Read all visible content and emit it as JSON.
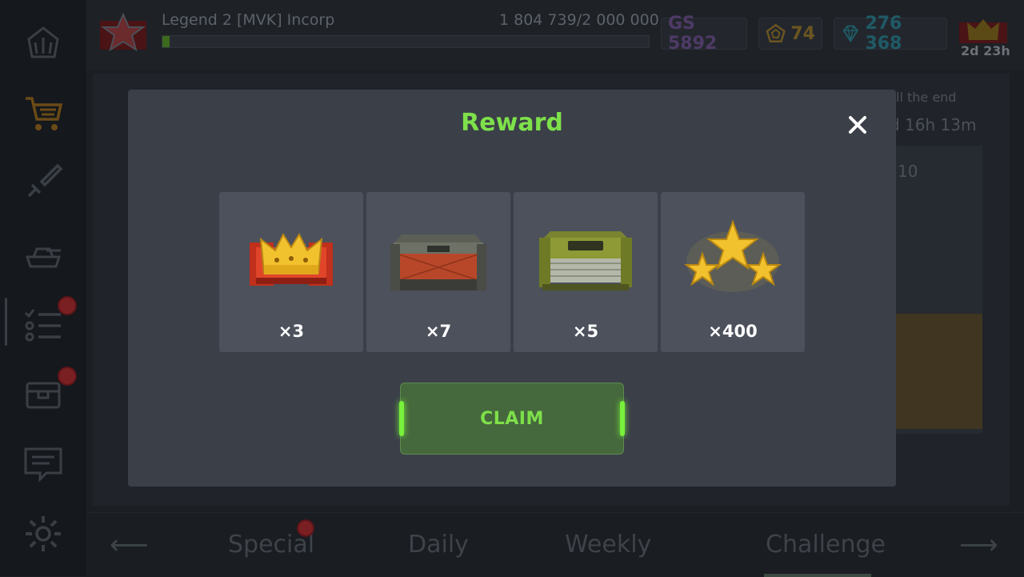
{
  "header": {
    "player_label": "Legend 2  [MVK] Incorp",
    "xp_text": "1 804 739/2 000 000",
    "xp_progress": 0.015,
    "gear_score": "GS 5892",
    "coins": "74",
    "gems": "276 368",
    "season_timer": "2d 23h"
  },
  "background": {
    "fragment_end": "ll the end",
    "fragment_timer": "d 16h 13m",
    "fragment_count": "10"
  },
  "tabs": [
    {
      "label": "Special"
    },
    {
      "label": "Daily"
    },
    {
      "label": "Weekly"
    },
    {
      "label": "Challenge"
    }
  ],
  "modal": {
    "title": "Reward",
    "close_icon": "close-icon",
    "rewards": [
      {
        "icon": "crown-icon",
        "count": "×3"
      },
      {
        "icon": "red-crate-icon",
        "count": "×7"
      },
      {
        "icon": "green-crate-icon",
        "count": "×5"
      },
      {
        "icon": "stars-icon",
        "count": "×400"
      }
    ],
    "claim_label": "CLAIM"
  },
  "colors": {
    "accent_green": "#7ee04a",
    "modal_bg": "#3b3f48",
    "card_bg": "#4c515c"
  }
}
